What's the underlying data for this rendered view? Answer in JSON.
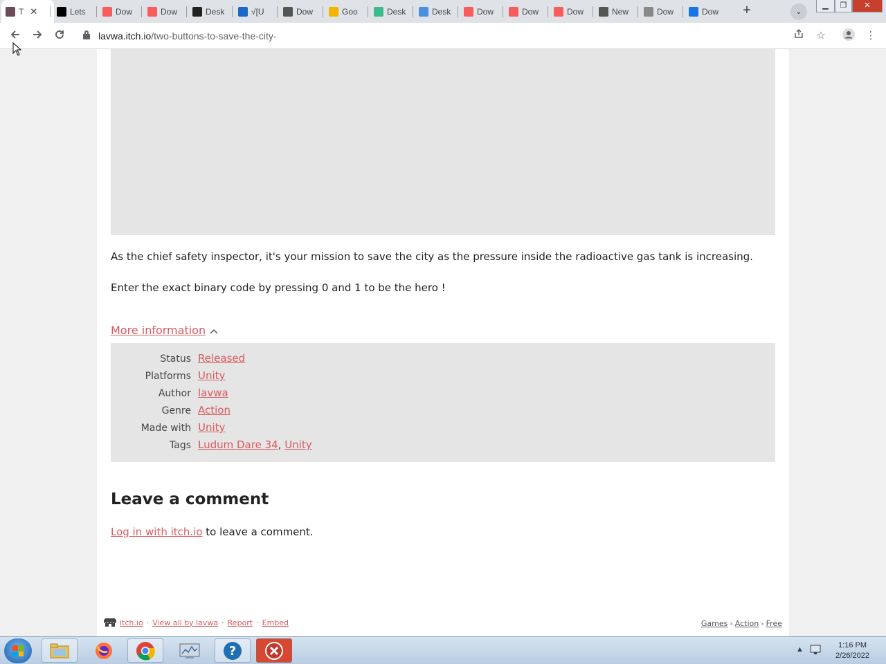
{
  "browser": {
    "tabs": [
      {
        "label": "T",
        "icon": "itch-favicon-icon",
        "color": "#6d4a5a",
        "active": true
      },
      {
        "label": "Lets",
        "icon": "black-square-icon",
        "color": "#000000"
      },
      {
        "label": "Dow",
        "icon": "itch-favicon-icon",
        "color": "#fa5c5c"
      },
      {
        "label": "Dow",
        "icon": "itch-favicon-icon",
        "color": "#fa5c5c"
      },
      {
        "label": "Desk",
        "icon": "app-icon",
        "color": "#222222"
      },
      {
        "label": "√[U",
        "icon": "99-icon",
        "color": "#1b6ac9"
      },
      {
        "label": "Dow",
        "icon": "globe-icon",
        "color": "#555555"
      },
      {
        "label": "Goo",
        "icon": "folder-icon",
        "color": "#f4b400"
      },
      {
        "label": "Desk",
        "icon": "image-icon",
        "color": "#3cba8b"
      },
      {
        "label": "Desk",
        "icon": "image-icon",
        "color": "#4a90e2"
      },
      {
        "label": "Dow",
        "icon": "itch-favicon-icon",
        "color": "#fa5c5c"
      },
      {
        "label": "Dow",
        "icon": "itch-favicon-icon",
        "color": "#fa5c5c"
      },
      {
        "label": "Dow",
        "icon": "itch-favicon-icon",
        "color": "#fa5c5c"
      },
      {
        "label": "New",
        "icon": "chrome-icon",
        "color": "#555555"
      },
      {
        "label": "Dow",
        "icon": "document-icon",
        "color": "#888888"
      },
      {
        "label": "Dow",
        "icon": "download-icon",
        "color": "#1a73e8"
      }
    ],
    "url_host": "lavwa.itch.io",
    "url_path": "/two-buttons-to-save-the-city-"
  },
  "page": {
    "description_1": "As the chief safety inspector, it's your mission to save the city as the pressure inside the radioactive gas tank is increasing.",
    "description_2": "Enter the exact binary code by pressing 0 and 1 to be the hero !",
    "more_info_label": "More information",
    "info": [
      {
        "key": "Status",
        "values": [
          "Released"
        ]
      },
      {
        "key": "Platforms",
        "values": [
          "Unity"
        ]
      },
      {
        "key": "Author",
        "values": [
          "lavwa"
        ]
      },
      {
        "key": "Genre",
        "values": [
          "Action"
        ]
      },
      {
        "key": "Made with",
        "values": [
          "Unity"
        ]
      },
      {
        "key": "Tags",
        "values": [
          "Ludum Dare 34",
          "Unity"
        ]
      }
    ],
    "comment_title": "Leave a comment",
    "login_link": "Log in with itch.io",
    "login_suffix": " to leave a comment."
  },
  "footer": {
    "links_left": [
      "itch.io",
      "View all by lavwa",
      "Report",
      "Embed"
    ],
    "separator": "·",
    "breadcrumbs": [
      "Games",
      "Action",
      "Free"
    ],
    "crumb_sep": "›"
  },
  "taskbar": {
    "time": "1:16 PM",
    "date": "2/26/2022"
  },
  "colors": {
    "link": "#da5a5f",
    "panel": "#e5e5e5"
  }
}
